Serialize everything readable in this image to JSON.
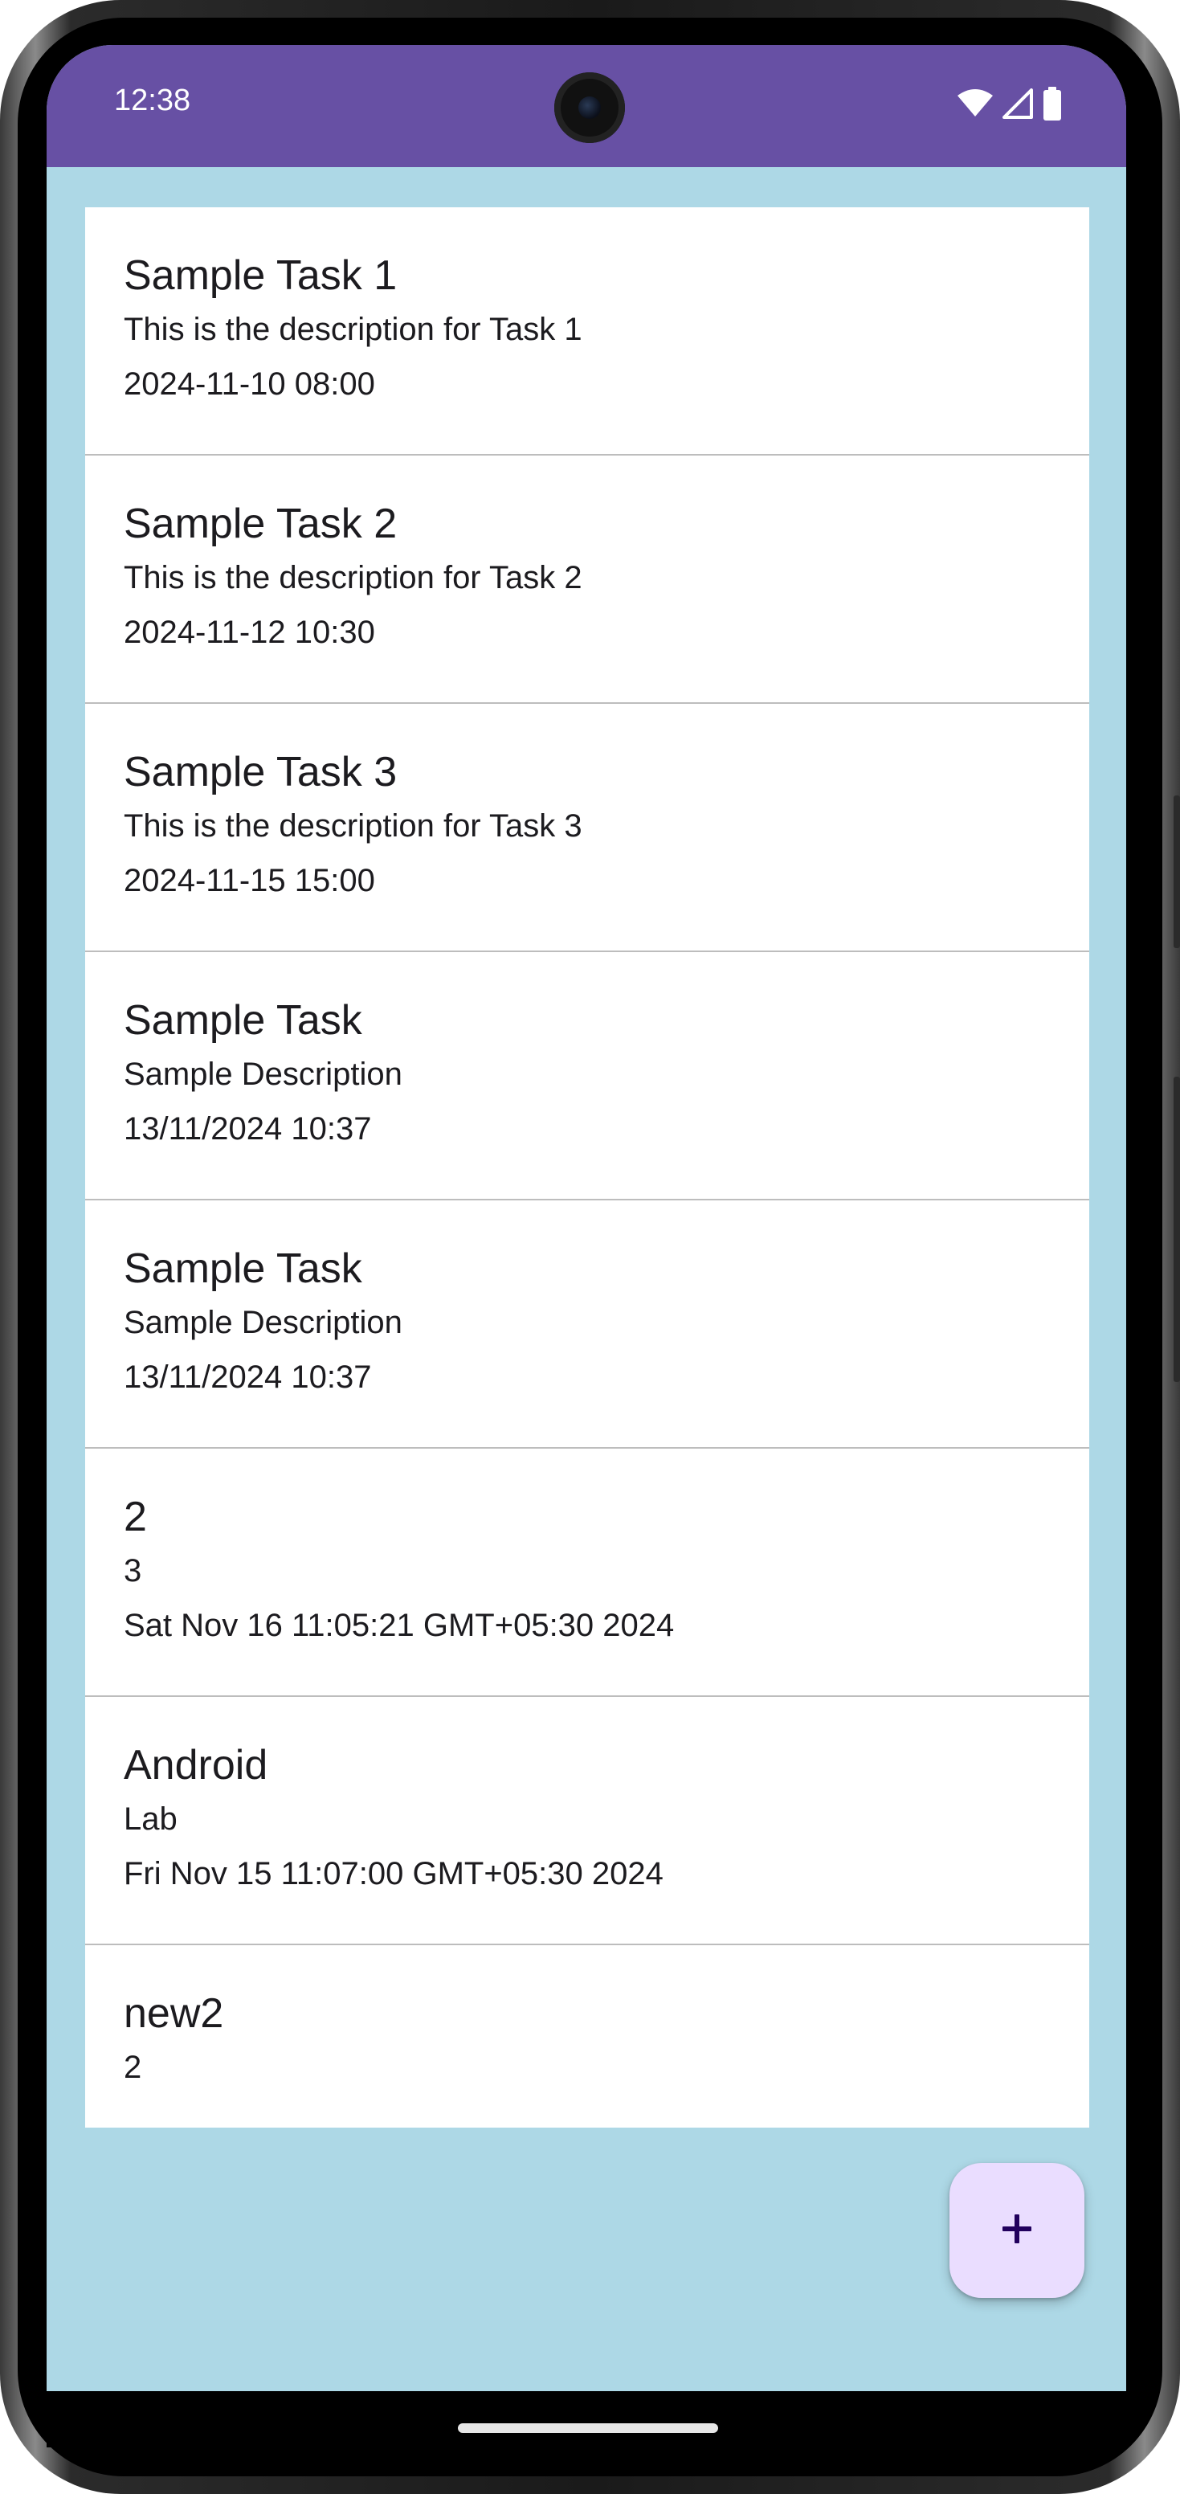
{
  "status_bar": {
    "time": "12:38",
    "icons": [
      "wifi-icon",
      "cellular-signal-icon",
      "battery-icon"
    ],
    "background": "#6750a4"
  },
  "app": {
    "background": "#add8e6"
  },
  "tasks": [
    {
      "title": "Sample Task 1",
      "description": "This is the description for Task 1",
      "date": "2024-11-10 08:00"
    },
    {
      "title": "Sample Task 2",
      "description": "This is the description for Task 2",
      "date": "2024-11-12 10:30"
    },
    {
      "title": "Sample Task 3",
      "description": "This is the description for Task 3",
      "date": "2024-11-15 15:00"
    },
    {
      "title": "Sample Task",
      "description": "Sample Description",
      "date": "13/11/2024 10:37"
    },
    {
      "title": "Sample Task",
      "description": "Sample Description",
      "date": "13/11/2024 10:37"
    },
    {
      "title": "2",
      "description": "3",
      "date": "Sat Nov 16 11:05:21 GMT+05:30 2024"
    },
    {
      "title": "Android",
      "description": "Lab",
      "date": "Fri Nov 15 11:07:00 GMT+05:30 2024"
    },
    {
      "title": "new2",
      "description": "2",
      "date": ""
    }
  ],
  "fab": {
    "icon": "plus-icon",
    "background": "#eaddff",
    "icon_color": "#21005d"
  }
}
